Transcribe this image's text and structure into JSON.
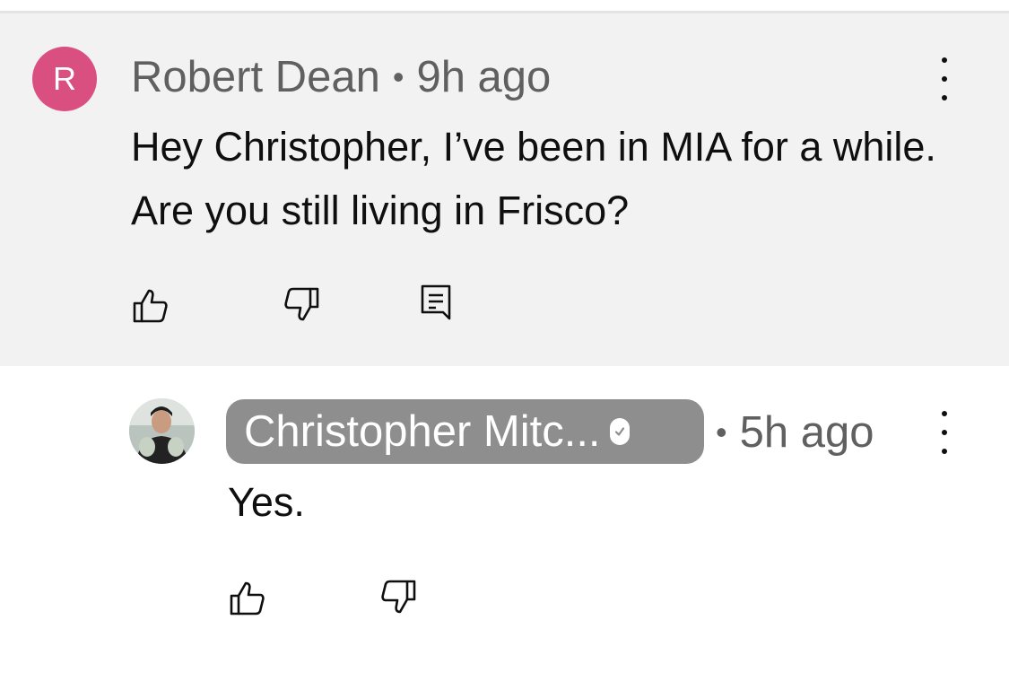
{
  "parent_comment": {
    "avatar_letter": "R",
    "author": "Robert Dean",
    "separator": "•",
    "time_ago": "9h ago",
    "text": "Hey Christopher, I’ve been in MIA for a while. Are you still living in Frisco?"
  },
  "reply": {
    "author": "Christopher Mitc...",
    "verified": true,
    "separator": "•",
    "time_ago": "5h ago",
    "text": "Yes."
  },
  "icons": {
    "like": "thumbs-up-icon",
    "dislike": "thumbs-down-icon",
    "reply": "reply-comment-icon",
    "more": "more-vertical-icon"
  },
  "colors": {
    "avatar_letter_bg": "#d94f7f",
    "highlight_bg": "#f2f2f2",
    "author_chip_bg": "#8e8e8e"
  }
}
